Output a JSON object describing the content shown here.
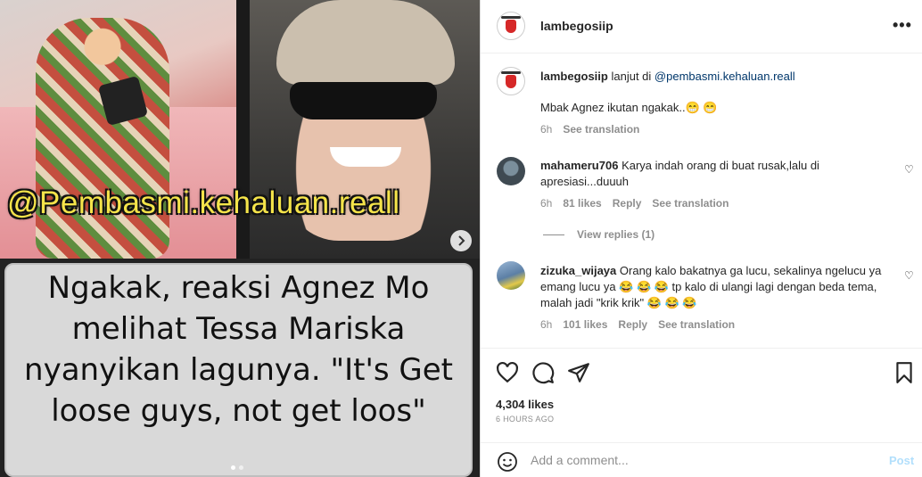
{
  "media": {
    "watermark_handle": "@Pembasmi.kehaluan.reall",
    "caption_text": "Ngakak, reaksi Agnez Mo melihat Tessa Mariska nyanyikan lagunya. \"It's Get loose guys, not get loos\"",
    "next_icon": "chevron-right-icon",
    "carousel": {
      "count": 2,
      "current": 1
    }
  },
  "header": {
    "username": "lambegosiip",
    "more_icon": "more-horizontal-icon",
    "more_label": "•••"
  },
  "post_caption": {
    "username": "lambegosiip",
    "text_prefix": "lanjut di",
    "mention": "@pembasmi.kehaluan.reall",
    "text": "Mbak Agnez ikutan ngakak..😁 😁",
    "time": "6h",
    "see_translation": "See translation"
  },
  "comments": [
    {
      "username": "mahameru706",
      "text": "Karya indah orang di buat rusak,lalu di apresiasi...duuuh",
      "time": "6h",
      "likes": "81 likes",
      "reply": "Reply",
      "see_translation": "See translation",
      "view_replies": "View replies (1)"
    },
    {
      "username": "zizuka_wijaya",
      "text": "Orang kalo bakatnya ga lucu, sekalinya ngelucu ya emang lucu ya 😂 😂 😂  tp kalo di ulangi lagi dengan beda tema, malah jadi \"krik krik\" 😂 😂 😂",
      "time": "6h",
      "likes": "101 likes",
      "reply": "Reply",
      "see_translation": "See translation"
    }
  ],
  "actions": {
    "like_icon": "heart-icon",
    "comment_icon": "comment-icon",
    "share_icon": "send-icon",
    "save_icon": "bookmark-icon",
    "likes_count": "4,304 likes",
    "posted_ago": "6 HOURS AGO"
  },
  "add_comment": {
    "placeholder": "Add a comment...",
    "post_label": "Post",
    "emoji_icon": "smiley-icon"
  },
  "colors": {
    "link": "#00376b",
    "muted": "#8e8e8e",
    "post_disabled": "#b2dffc",
    "handle_yellow": "#f5e44a"
  }
}
